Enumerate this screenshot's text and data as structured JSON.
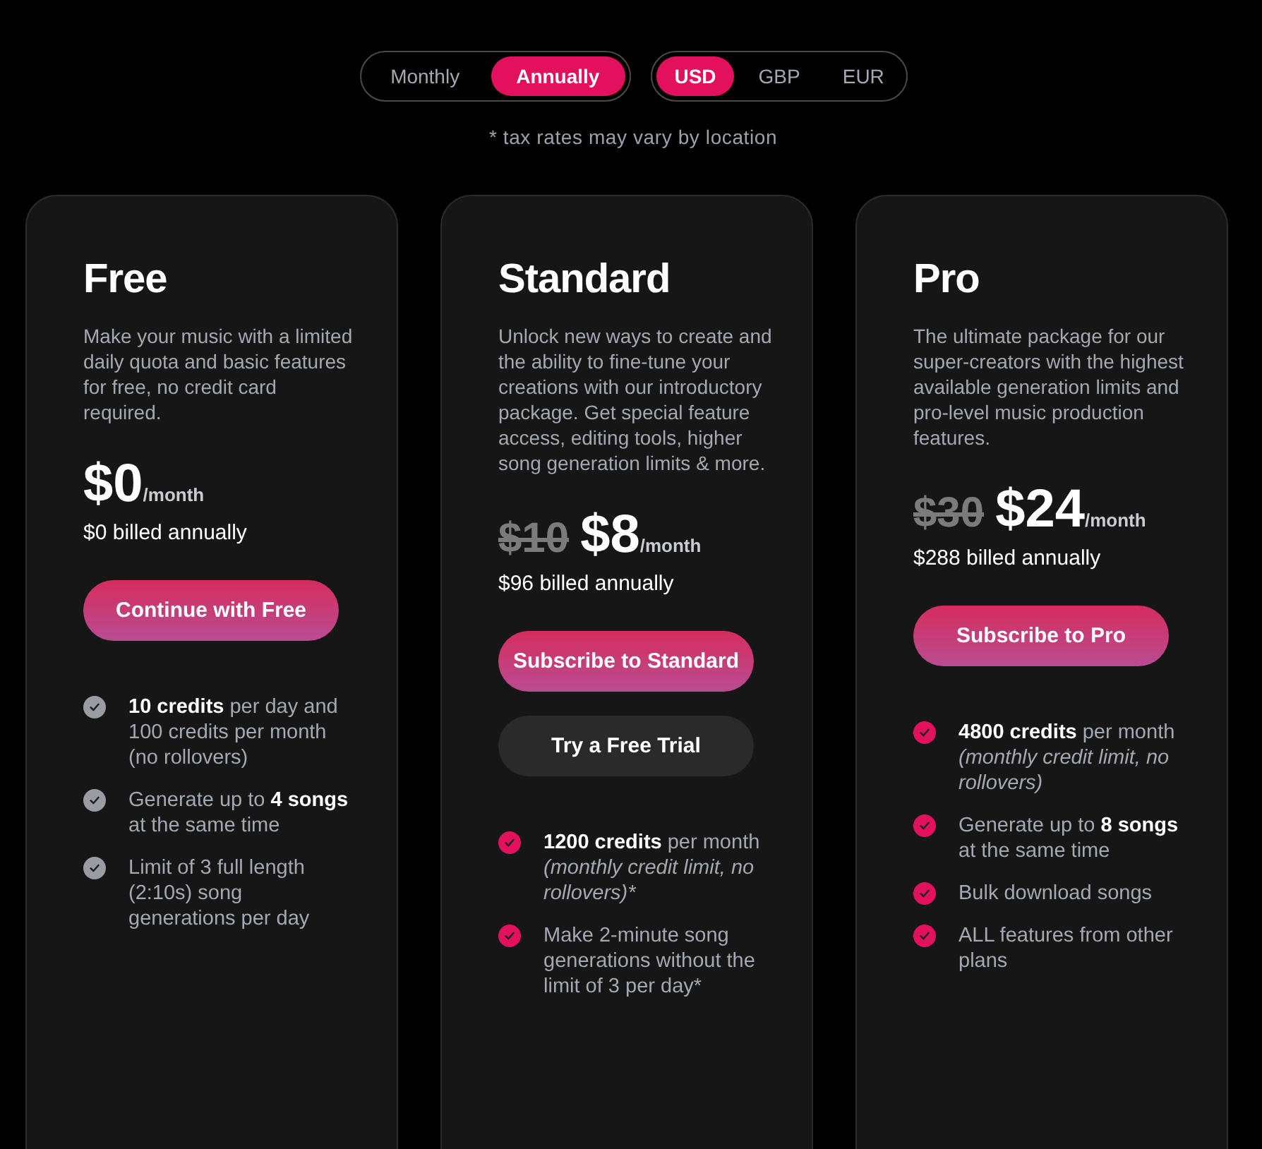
{
  "billing_toggle": [
    {
      "label": "Monthly",
      "selected": false
    },
    {
      "label": "Annually",
      "selected": true
    }
  ],
  "currency_toggle": [
    {
      "label": "USD",
      "selected": true
    },
    {
      "label": "GBP",
      "selected": false
    },
    {
      "label": "EUR",
      "selected": false
    }
  ],
  "tax_note": "* tax rates may vary by location",
  "plans": [
    {
      "kind": "free",
      "name": "Free",
      "description": "Make your music with a limited daily quota and basic features for free, no credit card required.",
      "price": "$0",
      "per": "/month",
      "billed": "$0 billed annually",
      "buttons": [
        {
          "label": "Continue with Free",
          "kind": "primary"
        }
      ],
      "features": [
        "**10 credits** per day and 100 credits per month (no rollovers)",
        "Generate up to **4 songs** at the same time",
        "Limit of 3 full length (2:10s) song generations per day"
      ]
    },
    {
      "kind": "paid",
      "name": "Standard",
      "description": "Unlock new ways to create and the ability to fine-tune your creations with our introductory package. Get special feature access, editing tools, higher song generation limits & more.",
      "old_price": "$10",
      "price": "$8",
      "per": "/month",
      "billed": "$96 billed annually",
      "footnotes": [
        "*"
      ],
      "buttons": [
        {
          "label": "Subscribe to Standard",
          "kind": "primary"
        },
        {
          "label": "Try a Free Trial",
          "kind": "secondary"
        }
      ],
      "features": [
        "**1200 credits** per month *(monthly credit limit, no rollovers)*",
        "Make 2-minute song generations without the limit of 3 per day*"
      ]
    },
    {
      "kind": "paid",
      "name": "Pro",
      "description": "The ultimate package for our super-creators with the highest available generation limits and pro-level music production features.",
      "old_price": "$30",
      "price": "$24",
      "per": "/month",
      "billed": "$288 billed annually",
      "buttons": [
        {
          "label": "Subscribe to Pro",
          "kind": "primary"
        }
      ],
      "features": [
        "**4800 credits** per month *(monthly credit limit, no rollovers)*",
        "Generate up to **8 songs** at the same time",
        "Bulk download songs",
        "ALL features from other plans"
      ]
    }
  ]
}
